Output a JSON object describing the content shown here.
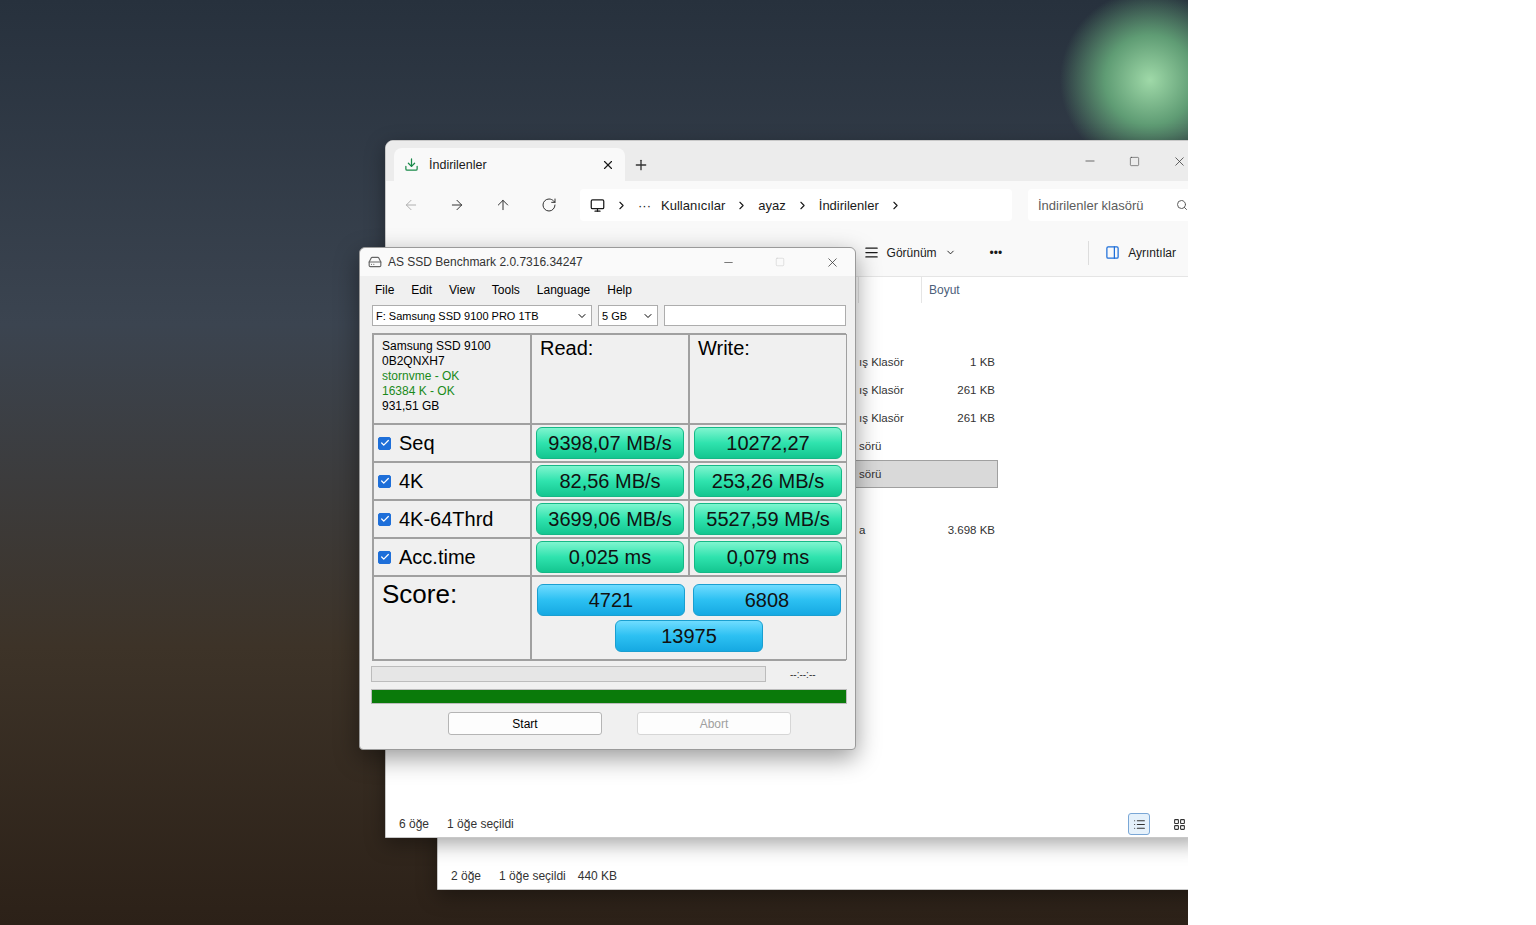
{
  "explorer_back": {
    "status_bar": {
      "count": "2 öğe",
      "selection": "1 öğe seçildi",
      "size": "440 KB"
    }
  },
  "explorer": {
    "tab": {
      "label": "İndirilenler",
      "selected": true
    },
    "nav": [
      {
        "action": "back",
        "disabled": true
      },
      {
        "action": "forward",
        "disabled": false
      },
      {
        "action": "up",
        "disabled": false
      },
      {
        "action": "refresh",
        "disabled": false
      }
    ],
    "address": {
      "overflow": "···",
      "crumbs": [
        "Kullanıcılar",
        "ayaz",
        "İndirilenler"
      ]
    },
    "search": {
      "placeholder": "İndirilenler klasörü"
    },
    "toolbar": {
      "view": "Görünüm",
      "more": "•••",
      "details": "Ayrıntılar"
    },
    "columns": [
      {
        "label": "Boyut"
      }
    ],
    "rows": [
      {
        "type": "ış Klasör",
        "size": "1 KB",
        "selected": false
      },
      {
        "type": "ış Klasör",
        "size": "261 KB",
        "selected": false
      },
      {
        "type": "ış Klasör",
        "size": "261 KB",
        "selected": false
      },
      {
        "type": "sörü",
        "size": "",
        "selected": false
      },
      {
        "type": "sörü",
        "size": "",
        "selected": true
      },
      {
        "type": "",
        "size": "",
        "selected": false
      },
      {
        "type": "a",
        "size": "3.698 KB",
        "selected": false
      }
    ],
    "status_bar": {
      "count": "6 öğe",
      "selection": "1 öğe seçildi"
    },
    "view_modes": [
      {
        "mode": "details",
        "selected": true
      },
      {
        "mode": "tiles",
        "selected": false
      }
    ]
  },
  "benchmark": {
    "window": {
      "title": "AS SSD Benchmark 2.0.7316.34247",
      "maximize_disabled": true
    },
    "menu": [
      "File",
      "Edit",
      "View",
      "Tools",
      "Language",
      "Help"
    ],
    "drive": "F: Samsung SSD 9100 PRO 1TB",
    "size": "5 GB",
    "field": "",
    "info": [
      {
        "text": "Samsung SSD 9100",
        "ok": false
      },
      {
        "text": "0B2QNXH7",
        "ok": false
      },
      {
        "text": "stornvme - OK",
        "ok": true
      },
      {
        "text": "16384 K - OK",
        "ok": true
      },
      {
        "text": "931,51 GB",
        "ok": false
      }
    ],
    "headers": {
      "read": "Read:",
      "write": "Write:"
    },
    "tests": [
      {
        "label": "Seq",
        "checked": true,
        "read": "9398,07 MB/s",
        "write": "10272,27"
      },
      {
        "label": "4K",
        "checked": true,
        "read": "82,56 MB/s",
        "write": "253,26 MB/s"
      },
      {
        "label": "4K-64Thrd",
        "checked": true,
        "read": "3699,06 MB/s",
        "write": "5527,59 MB/s"
      },
      {
        "label": "Acc.time",
        "checked": true,
        "read": "0,025 ms",
        "write": "0,079 ms"
      }
    ],
    "score": {
      "label": "Score:",
      "read": "4721",
      "write": "6808",
      "total": "13975"
    },
    "progress": {
      "level": 0,
      "time": "--:--:--"
    },
    "total_progress": {
      "level": 1
    },
    "buttons": [
      {
        "label": "Start",
        "disabled": false
      },
      {
        "label": "Abort",
        "disabled": true
      }
    ]
  }
}
